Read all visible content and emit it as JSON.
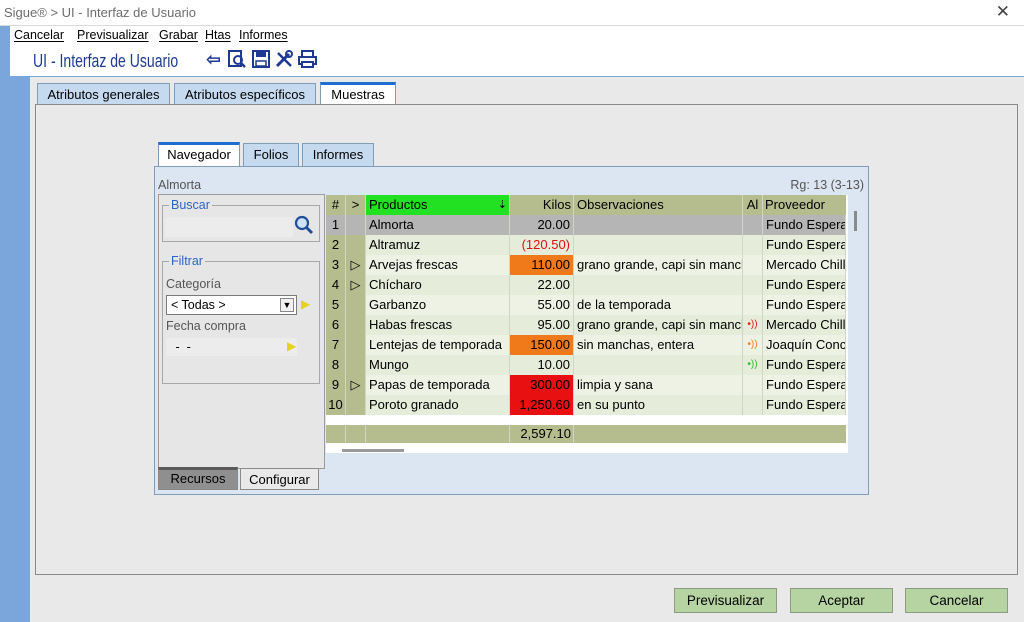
{
  "window": {
    "title": "Sigue® > UI - Interfaz de Usuario",
    "close": "✕"
  },
  "menu": [
    "Cancelar",
    "Previsualizar",
    "Grabar",
    "Htas",
    "Informes"
  ],
  "header": {
    "title": "UI - Interfaz de Usuario"
  },
  "tabs": [
    "Atributos generales",
    "Atributos específicos",
    "Muestras"
  ],
  "subtabs": [
    "Navegador",
    "Folios",
    "Informes"
  ],
  "navigator": {
    "record": "Almorta",
    "range": "Rg: 13 (3-13)"
  },
  "search": {
    "legend": "Buscar",
    "value": ""
  },
  "filter": {
    "legend": "Filtrar",
    "category_label": "Categoría",
    "category_value": "< Todas >",
    "date_label": "Fecha compra",
    "date_value": " -  - "
  },
  "bottom_tabs": [
    "Recursos",
    "Configurar"
  ],
  "grid": {
    "headers": [
      "#",
      ">",
      "Productos",
      "Kilos",
      "Observaciones",
      "Al",
      "Proveedor"
    ],
    "rows": [
      {
        "n": "1",
        "arrow": "",
        "product": "Almorta",
        "kilos": "20.00",
        "obs": "",
        "al": "",
        "prov": "Fundo Esperar",
        "kcolor": "",
        "alc": ""
      },
      {
        "n": "2",
        "arrow": "",
        "product": "Altramuz",
        "kilos": "(120.50)",
        "obs": "",
        "al": "",
        "prov": "Fundo Esperar",
        "kcolor": "neg",
        "alc": ""
      },
      {
        "n": "3",
        "arrow": "▷",
        "product": "Arvejas frescas",
        "kilos": "110.00",
        "obs": "grano grande, capi sin manchas",
        "al": "",
        "prov": "Mercado Chillá",
        "kcolor": "#f07a1a",
        "alc": ""
      },
      {
        "n": "4",
        "arrow": "▷",
        "product": "Chícharo",
        "kilos": "22.00",
        "obs": "",
        "al": "",
        "prov": "Fundo Esperar",
        "kcolor": "",
        "alc": ""
      },
      {
        "n": "5",
        "arrow": "",
        "product": "Garbanzo",
        "kilos": "55.00",
        "obs": "de la temporada",
        "al": "",
        "prov": "Fundo Esperar",
        "kcolor": "",
        "alc": ""
      },
      {
        "n": "6",
        "arrow": "",
        "product": "Habas frescas",
        "kilos": "95.00",
        "obs": "grano grande, capi sin manchas",
        "al": "•))",
        "prov": "Mercado Chillá",
        "kcolor": "",
        "alc": "#e01a1a"
      },
      {
        "n": "7",
        "arrow": "",
        "product": "Lentejas de temporada",
        "kilos": "150.00",
        "obs": "sin manchas, entera",
        "al": "•))",
        "prov": "Joaquín Conch",
        "kcolor": "#f07a1a",
        "alc": "#f07a1a"
      },
      {
        "n": "8",
        "arrow": "",
        "product": "Mungo",
        "kilos": "10.00",
        "obs": "",
        "al": "•))",
        "prov": "Fundo Esperar",
        "kcolor": "",
        "alc": "#2bbf2b"
      },
      {
        "n": "9",
        "arrow": "▷",
        "product": "Papas de temporada",
        "kilos": "300.00",
        "obs": "limpia y sana",
        "al": "",
        "prov": "Fundo Esperar",
        "kcolor": "#e81010",
        "alc": ""
      },
      {
        "n": "10",
        "arrow": "",
        "product": "Poroto granado",
        "kilos": "1,250.60",
        "obs": "en su punto",
        "al": "",
        "prov": "Fundo Esperar",
        "kcolor": "#e81010",
        "alc": ""
      }
    ],
    "total": "2,597.10"
  },
  "buttons": {
    "preview": "Previsualizar",
    "accept": "Aceptar",
    "cancel": "Cancelar"
  },
  "colors": {
    "accent": "#1e6ed2",
    "header_green": "#22e022",
    "grid_olive": "#b5bd8f",
    "button": "#b6d4a2"
  }
}
